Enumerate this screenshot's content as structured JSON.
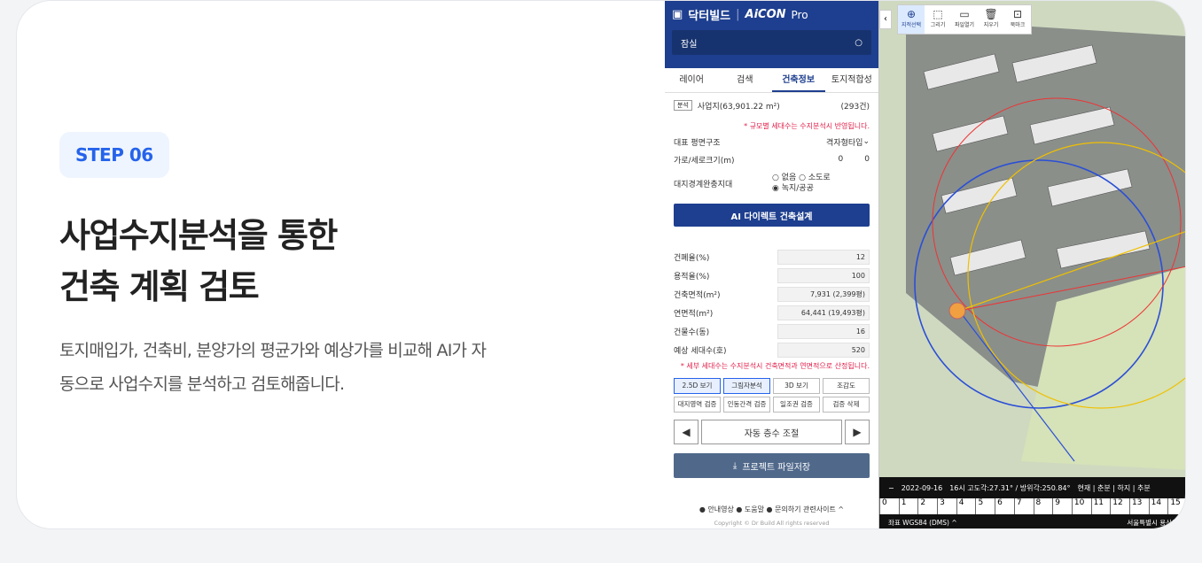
{
  "step_label": "STEP 06",
  "heading_line1": "사업수지분석을 통한",
  "heading_line2": "건축 계획 검토",
  "desc_line1": "토지매입가, 건축비, 분양가의 평균가와 예상가를 비교해 AI가 자",
  "desc_line2": "동으로 사업수지를 분석하고 검토해줍니다.",
  "app": {
    "brand": "닥터빌드",
    "logo": "AiCON",
    "logo_suffix": "Pro",
    "search_value": "잠실",
    "tabs": [
      "레이어",
      "검색",
      "건축정보",
      "토지적합성"
    ],
    "site_tag": "분석",
    "site_text": "사업지(63,901.22 m²)",
    "site_count": "(293건)",
    "note1": "* 규모별 세대수는 수지분석시 반영됩니다.",
    "plan_label": "대표 평면구조",
    "plan_value": "격자형타입",
    "size_label": "가로/세로크기(m)",
    "size_w": "0",
    "size_h": "0",
    "buffer_label": "대지경계완충지대",
    "radio1": "○ 없음",
    "radio2": "○ 소도로",
    "radio3": "◉ 녹지/공공",
    "ai_button": "AI 다이렉트 건축설계",
    "fields": [
      {
        "label": "건폐율(%)",
        "value": "12"
      },
      {
        "label": "용적율(%)",
        "value": "100"
      },
      {
        "label": "건축면적(m²)",
        "value": "7,931 (2,399평)"
      },
      {
        "label": "연면적(m²)",
        "value": "64,441 (19,493평)"
      },
      {
        "label": "건물수(동)",
        "value": "16"
      },
      {
        "label": "예상 세대수(호)",
        "value": "520"
      }
    ],
    "note2": "* 세부 세대수는 수지분석시 건축면적과 연면적으로 산정됩니다.",
    "btn_row1": [
      "2.5D 보기",
      "그림자분석",
      "3D 보기",
      "조감도"
    ],
    "btn_row2": [
      "대지영역 검증",
      "인동간격 검증",
      "일조권 검증",
      "검증 삭제"
    ],
    "auto_floor": "자동 층수 조절",
    "save_button": "프로젝트 파일저장",
    "footer_links": "● 안내영상  ● 도움말  ● 문의하기   관련사이트 ^",
    "copyright": "Copyright © Dr Build All rights reserved"
  },
  "map": {
    "tools": [
      "지적선택",
      "그리기",
      "파일열기",
      "지우기",
      "북마크"
    ],
    "date": "2022-09-16",
    "sun_info": "16시 고도각:27.31° / 방위각:250.84°",
    "time_modes": "현재 | 춘분 | 하지 | 추분",
    "ruler": [
      "0",
      "1",
      "2",
      "3",
      "4",
      "5",
      "6",
      "7",
      "8",
      "9",
      "10",
      "11",
      "12",
      "13",
      "14",
      "15"
    ],
    "coord": "좌표  WGS84 (DMS) ^",
    "region": "서울특별시 용산구"
  }
}
